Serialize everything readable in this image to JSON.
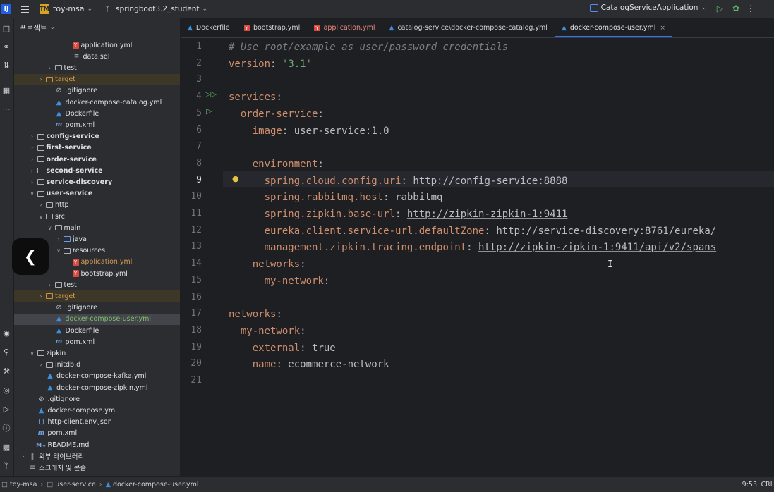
{
  "titlebar": {
    "logo": "IJ",
    "project_badge": "TM",
    "project_name": "toy-msa",
    "branch": "springboot3.2_student",
    "run_config": "CatalogServiceApplication",
    "icons": [
      "hamburger-menu-icon",
      "run-icon",
      "debug-icon",
      "more-icon"
    ]
  },
  "project_panel": {
    "header": "프로젝트",
    "rows": [
      {
        "label": "application.yml",
        "icon": "yml",
        "indent": 5,
        "arrow": "",
        "style": ""
      },
      {
        "label": "data.sql",
        "icon": "sql",
        "indent": 5,
        "arrow": "",
        "style": ""
      },
      {
        "label": "test",
        "icon": "folder",
        "indent": 3,
        "arrow": ">",
        "style": ""
      },
      {
        "label": "target",
        "icon": "folder-orange",
        "indent": 2,
        "arrow": ">",
        "style": "excluded"
      },
      {
        "label": ".gitignore",
        "icon": "git",
        "indent": 3,
        "arrow": "",
        "style": ""
      },
      {
        "label": "docker-compose-catalog.yml",
        "icon": "docker",
        "indent": 3,
        "arrow": "",
        "style": ""
      },
      {
        "label": "Dockerfile",
        "icon": "docker",
        "indent": 3,
        "arrow": "",
        "style": ""
      },
      {
        "label": "pom.xml",
        "icon": "maven",
        "indent": 3,
        "arrow": "",
        "style": ""
      },
      {
        "label": "config-service",
        "icon": "folder",
        "indent": 1,
        "arrow": ">",
        "style": "bold"
      },
      {
        "label": "first-service",
        "icon": "folder",
        "indent": 1,
        "arrow": ">",
        "style": "bold"
      },
      {
        "label": "order-service",
        "icon": "folder",
        "indent": 1,
        "arrow": ">",
        "style": "bold"
      },
      {
        "label": "second-service",
        "icon": "folder",
        "indent": 1,
        "arrow": ">",
        "style": "bold"
      },
      {
        "label": "service-discovery",
        "icon": "folder",
        "indent": 1,
        "arrow": ">",
        "style": "bold"
      },
      {
        "label": "user-service",
        "icon": "folder",
        "indent": 1,
        "arrow": "v",
        "style": "bold"
      },
      {
        "label": "http",
        "icon": "folder",
        "indent": 2,
        "arrow": ">",
        "style": ""
      },
      {
        "label": "src",
        "icon": "folder",
        "indent": 2,
        "arrow": "v",
        "style": ""
      },
      {
        "label": "main",
        "icon": "folder",
        "indent": 3,
        "arrow": "v",
        "style": ""
      },
      {
        "label": "java",
        "icon": "folder-blue",
        "indent": 4,
        "arrow": ">",
        "style": ""
      },
      {
        "label": "resources",
        "icon": "folder",
        "indent": 4,
        "arrow": "v",
        "style": ""
      },
      {
        "label": "application.yml",
        "icon": "yml",
        "indent": 5,
        "arrow": "",
        "style": "orange"
      },
      {
        "label": "bootstrap.yml",
        "icon": "yml",
        "indent": 5,
        "arrow": "",
        "style": ""
      },
      {
        "label": "test",
        "icon": "folder",
        "indent": 3,
        "arrow": ">",
        "style": ""
      },
      {
        "label": "target",
        "icon": "folder-orange",
        "indent": 2,
        "arrow": ">",
        "style": "excluded"
      },
      {
        "label": ".gitignore",
        "icon": "git",
        "indent": 3,
        "arrow": "",
        "style": ""
      },
      {
        "label": "docker-compose-user.yml",
        "icon": "docker",
        "indent": 3,
        "arrow": "",
        "style": "selected"
      },
      {
        "label": "Dockerfile",
        "icon": "docker",
        "indent": 3,
        "arrow": "",
        "style": ""
      },
      {
        "label": "pom.xml",
        "icon": "maven",
        "indent": 3,
        "arrow": "",
        "style": ""
      },
      {
        "label": "zipkin",
        "icon": "folder",
        "indent": 1,
        "arrow": "v",
        "style": ""
      },
      {
        "label": "initdb.d",
        "icon": "folder",
        "indent": 2,
        "arrow": ">",
        "style": ""
      },
      {
        "label": "docker-compose-kafka.yml",
        "icon": "docker",
        "indent": 2,
        "arrow": "",
        "style": ""
      },
      {
        "label": "docker-compose-zipkin.yml",
        "icon": "docker",
        "indent": 2,
        "arrow": "",
        "style": ""
      },
      {
        "label": ".gitignore",
        "icon": "git",
        "indent": 1,
        "arrow": "",
        "style": ""
      },
      {
        "label": "docker-compose.yml",
        "icon": "docker",
        "indent": 1,
        "arrow": "",
        "style": ""
      },
      {
        "label": "http-client.env.json",
        "icon": "json",
        "indent": 1,
        "arrow": "",
        "style": ""
      },
      {
        "label": "pom.xml",
        "icon": "maven",
        "indent": 1,
        "arrow": "",
        "style": ""
      },
      {
        "label": "README.md",
        "icon": "md",
        "indent": 1,
        "arrow": "",
        "style": ""
      },
      {
        "label": "외부 라이브러리",
        "icon": "lib",
        "indent": 0,
        "arrow": ">",
        "style": ""
      },
      {
        "label": "스크래치 및 콘솔",
        "icon": "scratch",
        "indent": 0,
        "arrow": "",
        "style": ""
      }
    ]
  },
  "tabs": [
    {
      "label": "Dockerfile",
      "icon": "docker",
      "active": false,
      "color": "normal"
    },
    {
      "label": "bootstrap.yml",
      "icon": "yml",
      "active": false,
      "color": "normal"
    },
    {
      "label": "application.yml",
      "icon": "yml",
      "active": false,
      "color": "orange"
    },
    {
      "label": "catalog-service\\docker-compose-catalog.yml",
      "icon": "docker",
      "active": false,
      "color": "normal"
    },
    {
      "label": "docker-compose-user.yml",
      "icon": "docker",
      "active": true,
      "color": "normal"
    }
  ],
  "editor": {
    "current_line": 9,
    "lines": [
      {
        "n": "1",
        "indent": 0,
        "parts": [
          [
            "c-comment",
            "# Use root/example as user/password credentials"
          ]
        ]
      },
      {
        "n": "2",
        "indent": 0,
        "parts": [
          [
            "c-key",
            "version"
          ],
          [
            "c-punc",
            ": "
          ],
          [
            "c-str",
            "'3.1'"
          ]
        ]
      },
      {
        "n": "3",
        "indent": 0,
        "parts": []
      },
      {
        "n": "4",
        "indent": 0,
        "parts": [
          [
            "c-key",
            "services"
          ],
          [
            "c-punc",
            ":"
          ]
        ]
      },
      {
        "n": "5",
        "indent": 2,
        "parts": [
          [
            "c-key",
            "order-service"
          ],
          [
            "c-punc",
            ":"
          ]
        ]
      },
      {
        "n": "6",
        "indent": 4,
        "parts": [
          [
            "c-key",
            "image"
          ],
          [
            "c-punc",
            ": "
          ],
          [
            "c-link",
            "user-service"
          ],
          [
            "c-val",
            ":1.0"
          ]
        ]
      },
      {
        "n": "7",
        "indent": 0,
        "parts": []
      },
      {
        "n": "8",
        "indent": 4,
        "parts": [
          [
            "c-key",
            "environment"
          ],
          [
            "c-punc",
            ":"
          ]
        ]
      },
      {
        "n": "9",
        "indent": 6,
        "parts": [
          [
            "c-key",
            "spring.cloud.config.uri"
          ],
          [
            "c-punc",
            ": "
          ],
          [
            "c-link",
            "http://config-service:8888"
          ]
        ]
      },
      {
        "n": "10",
        "indent": 6,
        "parts": [
          [
            "c-key",
            "spring.rabbitmq.host"
          ],
          [
            "c-punc",
            ": "
          ],
          [
            "c-val",
            "rabbitmq"
          ]
        ]
      },
      {
        "n": "11",
        "indent": 6,
        "parts": [
          [
            "c-key",
            "spring.zipkin.base-url"
          ],
          [
            "c-punc",
            ": "
          ],
          [
            "c-link",
            "http://zipkin-zipkin-1:9411"
          ]
        ]
      },
      {
        "n": "12",
        "indent": 6,
        "parts": [
          [
            "c-key",
            "eureka.client.service-url.defaultZone"
          ],
          [
            "c-punc",
            ": "
          ],
          [
            "c-link",
            "http://service-discovery:8761/eureka/"
          ]
        ]
      },
      {
        "n": "13",
        "indent": 6,
        "parts": [
          [
            "c-key",
            "management.zipkin.tracing.endpoint"
          ],
          [
            "c-punc",
            ": "
          ],
          [
            "c-link",
            "http://zipkin-zipkin-1:9411/api/v2/spans"
          ]
        ]
      },
      {
        "n": "14",
        "indent": 4,
        "parts": [
          [
            "c-key",
            "networks"
          ],
          [
            "c-punc",
            ":"
          ]
        ]
      },
      {
        "n": "15",
        "indent": 6,
        "parts": [
          [
            "c-key",
            "my-network"
          ],
          [
            "c-punc",
            ":"
          ]
        ]
      },
      {
        "n": "16",
        "indent": 0,
        "parts": []
      },
      {
        "n": "17",
        "indent": 0,
        "parts": [
          [
            "c-key",
            "networks"
          ],
          [
            "c-punc",
            ":"
          ]
        ]
      },
      {
        "n": "18",
        "indent": 2,
        "parts": [
          [
            "c-key",
            "my-network"
          ],
          [
            "c-punc",
            ":"
          ]
        ]
      },
      {
        "n": "19",
        "indent": 4,
        "parts": [
          [
            "c-key",
            "external"
          ],
          [
            "c-punc",
            ": "
          ],
          [
            "c-val",
            "true"
          ]
        ]
      },
      {
        "n": "20",
        "indent": 4,
        "parts": [
          [
            "c-key",
            "name"
          ],
          [
            "c-punc",
            ": "
          ],
          [
            "c-val",
            "ecommerce-network"
          ]
        ]
      },
      {
        "n": "21",
        "indent": 0,
        "parts": []
      }
    ]
  },
  "statusbar": {
    "crumbs": [
      "toy-msa",
      "user-service",
      "docker-compose-user.yml"
    ],
    "position": "9:53",
    "encoding": "CRL"
  }
}
